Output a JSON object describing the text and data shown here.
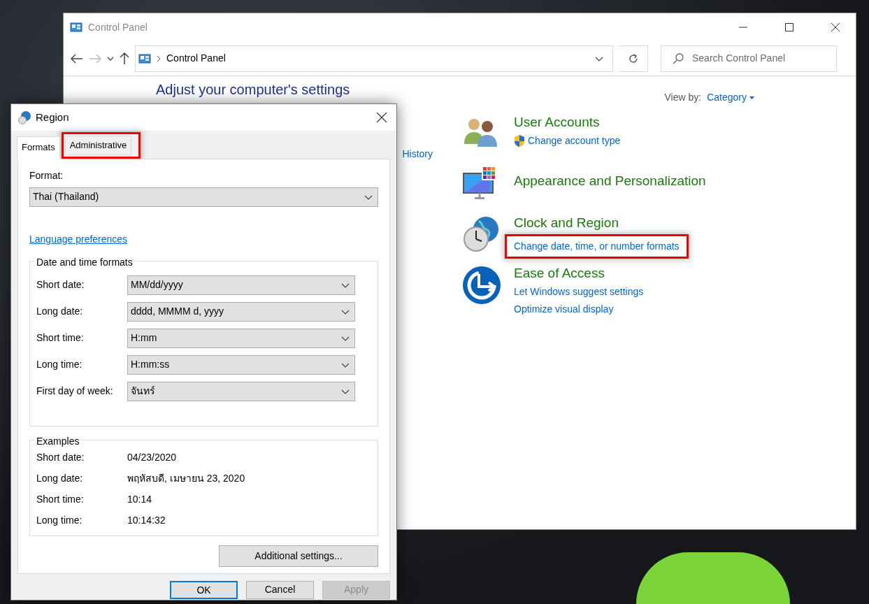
{
  "control_panel": {
    "title": "Control Panel",
    "address": "Control Panel",
    "search": {
      "placeholder": "Search Control Panel"
    },
    "heading": "Adjust your computer's settings",
    "view_by": {
      "label": "View by:",
      "value": "Category"
    },
    "left_links": [
      "History"
    ],
    "categories": [
      {
        "kind": "users",
        "title": "User Accounts",
        "links": [
          {
            "text": "Change account type",
            "shield": true
          }
        ]
      },
      {
        "kind": "appearance",
        "title": "Appearance and Personalization"
      },
      {
        "kind": "clock",
        "title": "Clock and Region",
        "links": [
          {
            "text": "Change date, time, or number formats",
            "shield": false,
            "highlighted": true
          }
        ]
      },
      {
        "kind": "access",
        "title": "Ease of Access",
        "links": [
          {
            "text": "Let Windows suggest settings",
            "shield": false
          },
          {
            "text": "Optimize visual display",
            "shield": false
          }
        ]
      }
    ]
  },
  "region_dialog": {
    "title": "Region",
    "tabs": [
      {
        "label": "Formats",
        "selected": true
      },
      {
        "label": "Administrative",
        "selected": false,
        "highlighted": true
      }
    ],
    "format": {
      "label": "Format:",
      "value": "Thai (Thailand)"
    },
    "language_link": "Language preferences",
    "date_time_formats": {
      "title": "Date and time formats",
      "rows": [
        {
          "label": "Short date:",
          "value": "MM/dd/yyyy"
        },
        {
          "label": "Long date:",
          "value": "dddd, MMMM d, yyyy"
        },
        {
          "label": "Short time:",
          "value": "H:mm"
        },
        {
          "label": "Long time:",
          "value": "H:mm:ss"
        },
        {
          "label": "First day of week:",
          "value": "จันทร์"
        }
      ]
    },
    "examples": {
      "title": "Examples",
      "rows": [
        {
          "label": "Short date:",
          "value": "04/23/2020"
        },
        {
          "label": "Long date:",
          "value": "พฤหัสบดี, เมษายน 23, 2020"
        },
        {
          "label": "Short time:",
          "value": "10:14"
        },
        {
          "label": "Long time:",
          "value": "10:14:32"
        }
      ]
    },
    "additional_button": "Additional settings...",
    "buttons": [
      {
        "label": "OK",
        "default": true,
        "disabled": false
      },
      {
        "label": "Cancel",
        "default": false,
        "disabled": false
      },
      {
        "label": "Apply",
        "default": false,
        "disabled": true
      }
    ]
  }
}
